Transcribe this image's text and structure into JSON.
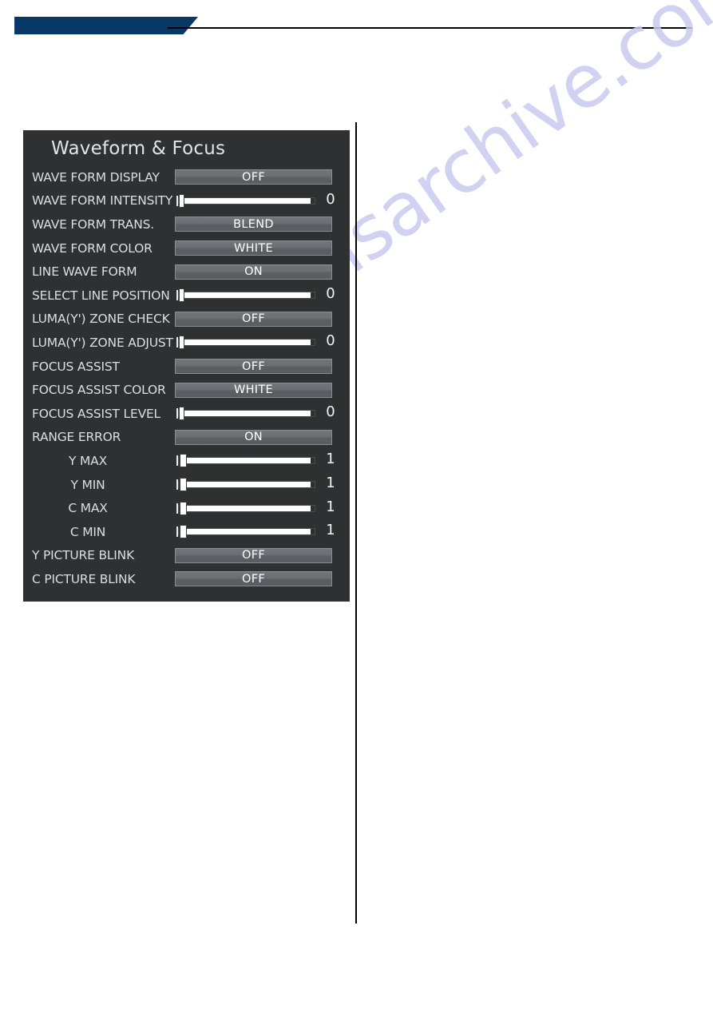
{
  "header": {
    "banner_color": "#073868",
    "rule_color": "#000000"
  },
  "watermark": {
    "text": "manualsarchive.com",
    "color": "#c9cbf0"
  },
  "osd": {
    "title": "Waveform & Focus",
    "panel_bg": "#2e3032",
    "label_color": "#dcdedf",
    "pill_color": "#6a6e72",
    "rows": [
      {
        "label": "WAVE FORM DISPLAY",
        "type": "option",
        "value": "OFF",
        "indented": false
      },
      {
        "label": "WAVE FORM INTENSITY",
        "type": "slider",
        "value": "0",
        "indented": false,
        "wide": false
      },
      {
        "label": "WAVE FORM TRANS.",
        "type": "option",
        "value": "BLEND",
        "indented": false
      },
      {
        "label": "WAVE FORM COLOR",
        "type": "option",
        "value": "WHITE",
        "indented": false
      },
      {
        "label": "LINE WAVE FORM",
        "type": "option",
        "value": "ON",
        "indented": false
      },
      {
        "label": "SELECT LINE POSITION",
        "type": "slider",
        "value": "0",
        "indented": false,
        "wide": false
      },
      {
        "label": "LUMA(Y') ZONE CHECK",
        "type": "option",
        "value": "OFF",
        "indented": false
      },
      {
        "label": "LUMA(Y') ZONE ADJUST",
        "type": "slider",
        "value": "0",
        "indented": false,
        "wide": false
      },
      {
        "label": "FOCUS ASSIST",
        "type": "option",
        "value": "OFF",
        "indented": false
      },
      {
        "label": "FOCUS ASSIST COLOR",
        "type": "option",
        "value": "WHITE",
        "indented": false
      },
      {
        "label": "FOCUS ASSIST LEVEL",
        "type": "slider",
        "value": "0",
        "indented": false,
        "wide": false
      },
      {
        "label": "RANGE ERROR",
        "type": "option",
        "value": "ON",
        "indented": false
      },
      {
        "label": "Y MAX",
        "type": "slider",
        "value": "1",
        "indented": true,
        "wide": true
      },
      {
        "label": "Y MIN",
        "type": "slider",
        "value": "1",
        "indented": true,
        "wide": true
      },
      {
        "label": "C MAX",
        "type": "slider",
        "value": "1",
        "indented": true,
        "wide": true
      },
      {
        "label": "C MIN",
        "type": "slider",
        "value": "1",
        "indented": true,
        "wide": true
      },
      {
        "label": "Y PICTURE BLINK",
        "type": "option",
        "value": "OFF",
        "indented": false
      },
      {
        "label": "C PICTURE BLINK",
        "type": "option",
        "value": "OFF",
        "indented": false
      }
    ]
  }
}
